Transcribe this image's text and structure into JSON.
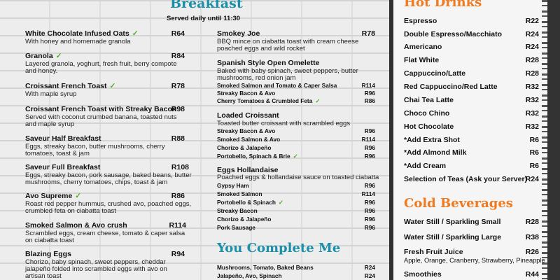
{
  "breakfast": {
    "title": "Breakfast",
    "subtitle": "Served daily until 11:30",
    "veg_mark": "✓",
    "left_items": [
      {
        "title": "White Chocolate Infused Oats",
        "price": "R64",
        "desc": "With honey and homemade granola"
      },
      {
        "title": "Granola",
        "price": "R84",
        "desc": "Layered granola, yoghurt, fresh fruit, berry compote and honey."
      },
      {
        "title": "Croissant French Toast",
        "price": "R78",
        "desc": "With maple syrup"
      },
      {
        "title": "Croissant French Toast with Streaky Bacon",
        "price": "R98",
        "desc": "Served with coconut crumbed banana, toasted nuts and maple syrup"
      },
      {
        "title": "Saveur Half Breakfast",
        "price": "R88",
        "desc": "Eggs, streaky bacon, butter mushrooms, cherry tomatoes, toast & jam"
      },
      {
        "title": "Saveur Full Breakfast",
        "price": "R108",
        "desc": "Eggs, streaky bacon, pork sausage, baked beans, butter mushrooms, cherry tomatoes, chips, toast & jam"
      },
      {
        "title": "Avo Supreme",
        "price": "R86",
        "desc": "Roast red pepper hummus, crushed avo, poached eggs, crumbled feta on ciabatta toast"
      },
      {
        "title": "Smoked Salmon & Avo crush",
        "price": "R114",
        "desc": "Scrambled eggs, cream cheese, tomato & caper salsa on ciabatta toast"
      },
      {
        "title": "Blazing Eggs",
        "price": "R94",
        "desc": "Chorizo, baby spinach, sweet peppers, cheddar jalapeño folded into scrambled eggs with avo on artisan toast"
      }
    ],
    "smokey_joe": {
      "title": "Smokey Joe",
      "price": "R78",
      "desc": "BBQ mince on ciabatta toast with cream cheese poached eggs and wild rocket"
    },
    "omelette": {
      "title": "Spanish Style Open Omelette",
      "desc": "Baked with baby spinach, sweet peppers, butter mushrooms, red onion jam",
      "options": [
        {
          "name": "Smoked Salmon and Tomato & Caper Salsa",
          "price": "R114"
        },
        {
          "name": "Streaky Bacon & Avo",
          "price": "R96"
        },
        {
          "name": "Cherry Tomatoes & Crumbled Feta",
          "price": "R86"
        }
      ]
    },
    "croissant": {
      "title": "Loaded Croissant",
      "desc": "Toasted butter croissant with scrambled eggs",
      "options": [
        {
          "name": "Streaky Bacon & Avo",
          "price": "R96"
        },
        {
          "name": "Smoked Salmon & Avo",
          "price": "R114"
        },
        {
          "name": "Chorizo & Jalapeño",
          "price": "R96"
        },
        {
          "name": "Portobello, Spinach & Brie",
          "price": "R96"
        }
      ]
    },
    "hollandaise": {
      "title": "Eggs Hollandaise",
      "desc": "Poached eggs & hollandaise sauce on toasted ciabatta",
      "options": [
        {
          "name": "Gypsy Ham",
          "price": "R96"
        },
        {
          "name": "Smoked Salmon",
          "price": "R114"
        },
        {
          "name": "Portobello & Spinach",
          "price": "R96"
        },
        {
          "name": "Streaky Bacon",
          "price": "R96"
        },
        {
          "name": "Chorizo & Jalapeño",
          "price": "R96"
        },
        {
          "name": "Pork Sausage",
          "price": "R96"
        }
      ]
    }
  },
  "complete": {
    "title": "You Complete Me",
    "items": [
      {
        "name": "Mushrooms, Tomato, Baked Beans",
        "price": "R24"
      },
      {
        "name": "Jalapeño, Avo, Spinach",
        "price": "R24"
      }
    ]
  },
  "hot_drinks": {
    "title": "Hot Drinks",
    "items": [
      {
        "name": "Espresso",
        "price": "R22"
      },
      {
        "name": "Double Espresso/Macchiato",
        "price": "R24"
      },
      {
        "name": "Americano",
        "price": "R24"
      },
      {
        "name": "Flat White",
        "price": "R28"
      },
      {
        "name": "Cappuccino/Latte",
        "price": "R28"
      },
      {
        "name": "Red Cappuccino/Red Latte",
        "price": "R32"
      },
      {
        "name": "Chai Tea Latte",
        "price": "R32"
      },
      {
        "name": "Choco Chino",
        "price": "R32"
      },
      {
        "name": "Hot Chocolate",
        "price": "R32"
      },
      {
        "name": "*Add Extra Shot",
        "price": "R6"
      },
      {
        "name": "*Add Almond Milk",
        "price": "R6"
      },
      {
        "name": "*Add Cream",
        "price": "R6"
      },
      {
        "name": "Selection of Teas (Ask your Server)",
        "price": "R24"
      }
    ]
  },
  "cold_beverages": {
    "title": "Cold Beverages",
    "items": [
      {
        "name": "Water Still / Sparkling Small",
        "price": "R28"
      },
      {
        "name": "Water Still / Sparkling Large",
        "price": "R38"
      },
      {
        "name": "Fresh Fruit Juice",
        "price": "R26",
        "desc": "Apple, Orange, Cranberry, Strawberry, Pineapple"
      },
      {
        "name": "Smoothies",
        "price": "R44"
      }
    ]
  },
  "colors": {
    "teal": "#1a8fa8",
    "orange": "#ef7a1f"
  }
}
